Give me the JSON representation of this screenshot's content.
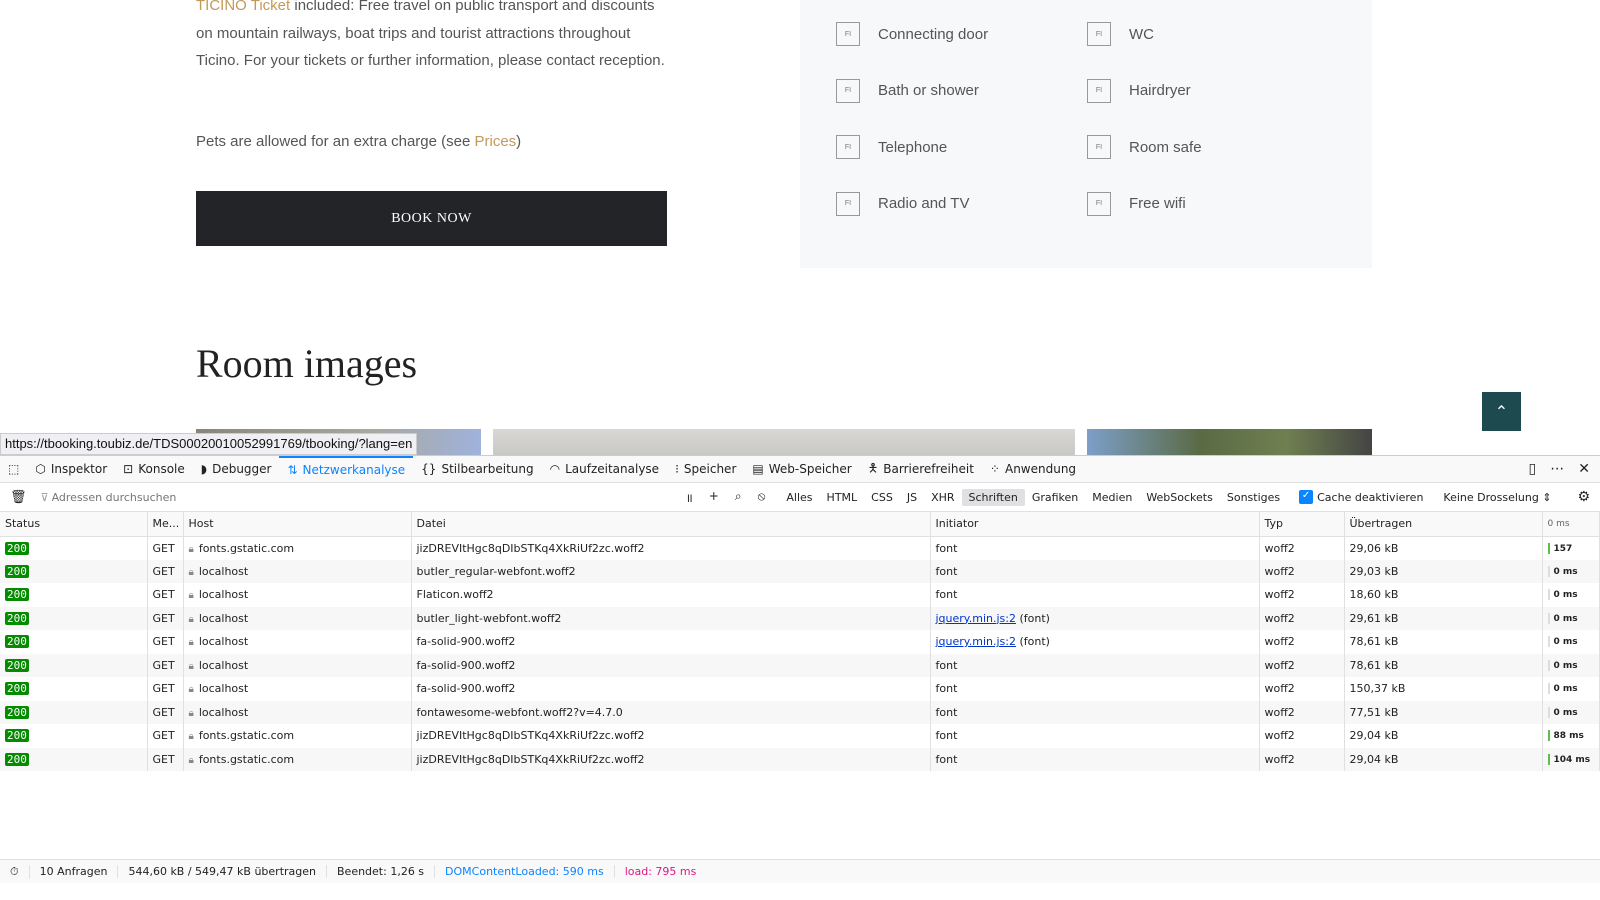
{
  "page": {
    "ticket_link": "TICINO Ticket",
    "para1_rest": " included: Free travel on public transport and discounts on mountain railways, boat trips and tourist attractions throughout Ticino. For your tickets or further information, please contact reception.",
    "pets_text": "Pets are allowed for an extra charge (see ",
    "prices_link": "Prices",
    "pets_close": ")",
    "book_now": "BOOK NOW",
    "amenities": [
      "Connecting door",
      "WC",
      "Bath or shower",
      "Hairdryer",
      "Telephone",
      "Room safe",
      "Radio and TV",
      "Free wifi"
    ],
    "room_images_title": "Room images",
    "scroll_top": "⌃"
  },
  "status_url": "https://tbooking.toubiz.de/TDS00020010052991769/tbooking/?lang=en",
  "devtools": {
    "tabs": [
      "Inspektor",
      "Konsole",
      "Debugger",
      "Netzwerkanalyse",
      "Stilbearbeitung",
      "Laufzeitanalyse",
      "Speicher",
      "Web-Speicher",
      "Barrierefreiheit",
      "Anwendung"
    ],
    "filter_placeholder": "Adressen durchsuchen",
    "filters": [
      "Alles",
      "HTML",
      "CSS",
      "JS",
      "XHR",
      "Schriften",
      "Grafiken",
      "Medien",
      "WebSockets",
      "Sonstiges"
    ],
    "cache_label": "Cache deaktivieren",
    "throttle": "Keine Drosselung",
    "columns": [
      "Status",
      "Me...",
      "Host",
      "Datei",
      "Initiator",
      "Typ",
      "Übertragen",
      "0 ms"
    ],
    "rows": [
      [
        "200",
        "GET",
        "fonts.gstatic.com",
        "jizDREVItHgc8qDIbSTKq4XkRiUf2zc.woff2",
        "font",
        "",
        "woff2",
        "29,06 kB",
        "157"
      ],
      [
        "200",
        "GET",
        "localhost",
        "butler_regular-webfont.woff2",
        "font",
        "",
        "woff2",
        "29,03 kB",
        "0 ms"
      ],
      [
        "200",
        "GET",
        "localhost",
        "Flaticon.woff2",
        "font",
        "",
        "woff2",
        "18,60 kB",
        "0 ms"
      ],
      [
        "200",
        "GET",
        "localhost",
        "butler_light-webfont.woff2",
        "jquery.min.js:2",
        " (font)",
        "woff2",
        "29,61 kB",
        "0 ms"
      ],
      [
        "200",
        "GET",
        "localhost",
        "fa-solid-900.woff2",
        "jquery.min.js:2",
        " (font)",
        "woff2",
        "78,61 kB",
        "0 ms"
      ],
      [
        "200",
        "GET",
        "localhost",
        "fa-solid-900.woff2",
        "font",
        "",
        "woff2",
        "78,61 kB",
        "0 ms"
      ],
      [
        "200",
        "GET",
        "localhost",
        "fa-solid-900.woff2",
        "font",
        "",
        "woff2",
        "150,37 kB",
        "0 ms"
      ],
      [
        "200",
        "GET",
        "localhost",
        "fontawesome-webfont.woff2?v=4.7.0",
        "font",
        "",
        "woff2",
        "77,51 kB",
        "0 ms"
      ],
      [
        "200",
        "GET",
        "fonts.gstatic.com",
        "jizDREVItHgc8qDIbSTKq4XkRiUf2zc.woff2",
        "font",
        "",
        "woff2",
        "29,04 kB",
        "88 ms"
      ],
      [
        "200",
        "GET",
        "fonts.gstatic.com",
        "jizDREVItHgc8qDIbSTKq4XkRiUf2zc.woff2",
        "font",
        "",
        "woff2",
        "29,04 kB",
        "104 ms"
      ]
    ],
    "status": {
      "requests": "10 Anfragen",
      "transferred": "544,60 kB / 549,47 kB übertragen",
      "finished": "Beendet: 1,26 s",
      "dcl": "DOMContentLoaded: 590 ms",
      "load": "load: 795 ms"
    }
  }
}
